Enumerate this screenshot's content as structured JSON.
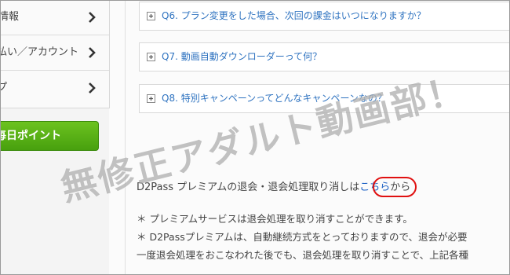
{
  "sidebar": {
    "items": [
      {
        "label": "情報"
      },
      {
        "label": "払い／アカウント"
      },
      {
        "label": "プ"
      }
    ],
    "point_button_label": "毎日ポイント"
  },
  "faq": [
    {
      "question": "Q6. プラン変更をした場合、次回の課金はいつになりますか？"
    },
    {
      "question": "Q7. 動画自動ダウンローダーって何？"
    },
    {
      "question": "Q8. 特別キャンペーンってどんなキャンペーンなの？"
    }
  ],
  "notice": {
    "prefix": "D2Pass プレミアムの退会・退会処理取り消しは",
    "link_text": "こちら",
    "suffix": "から"
  },
  "notes": [
    "＊ プレミアムサービスは退会処理を取り消すことができます。",
    "＊ D2Passプレミアムは、自動継続方式をとっておりますので、退会が必要",
    "一度退会処理をおこなわれた後でも、退会処理を取り消すことで、上記各種"
  ],
  "watermark": "無修正アダルト動画部！",
  "colors": {
    "link": "#2f73c0",
    "button_green": "#55ab15",
    "highlight_circle": "#e01010"
  }
}
